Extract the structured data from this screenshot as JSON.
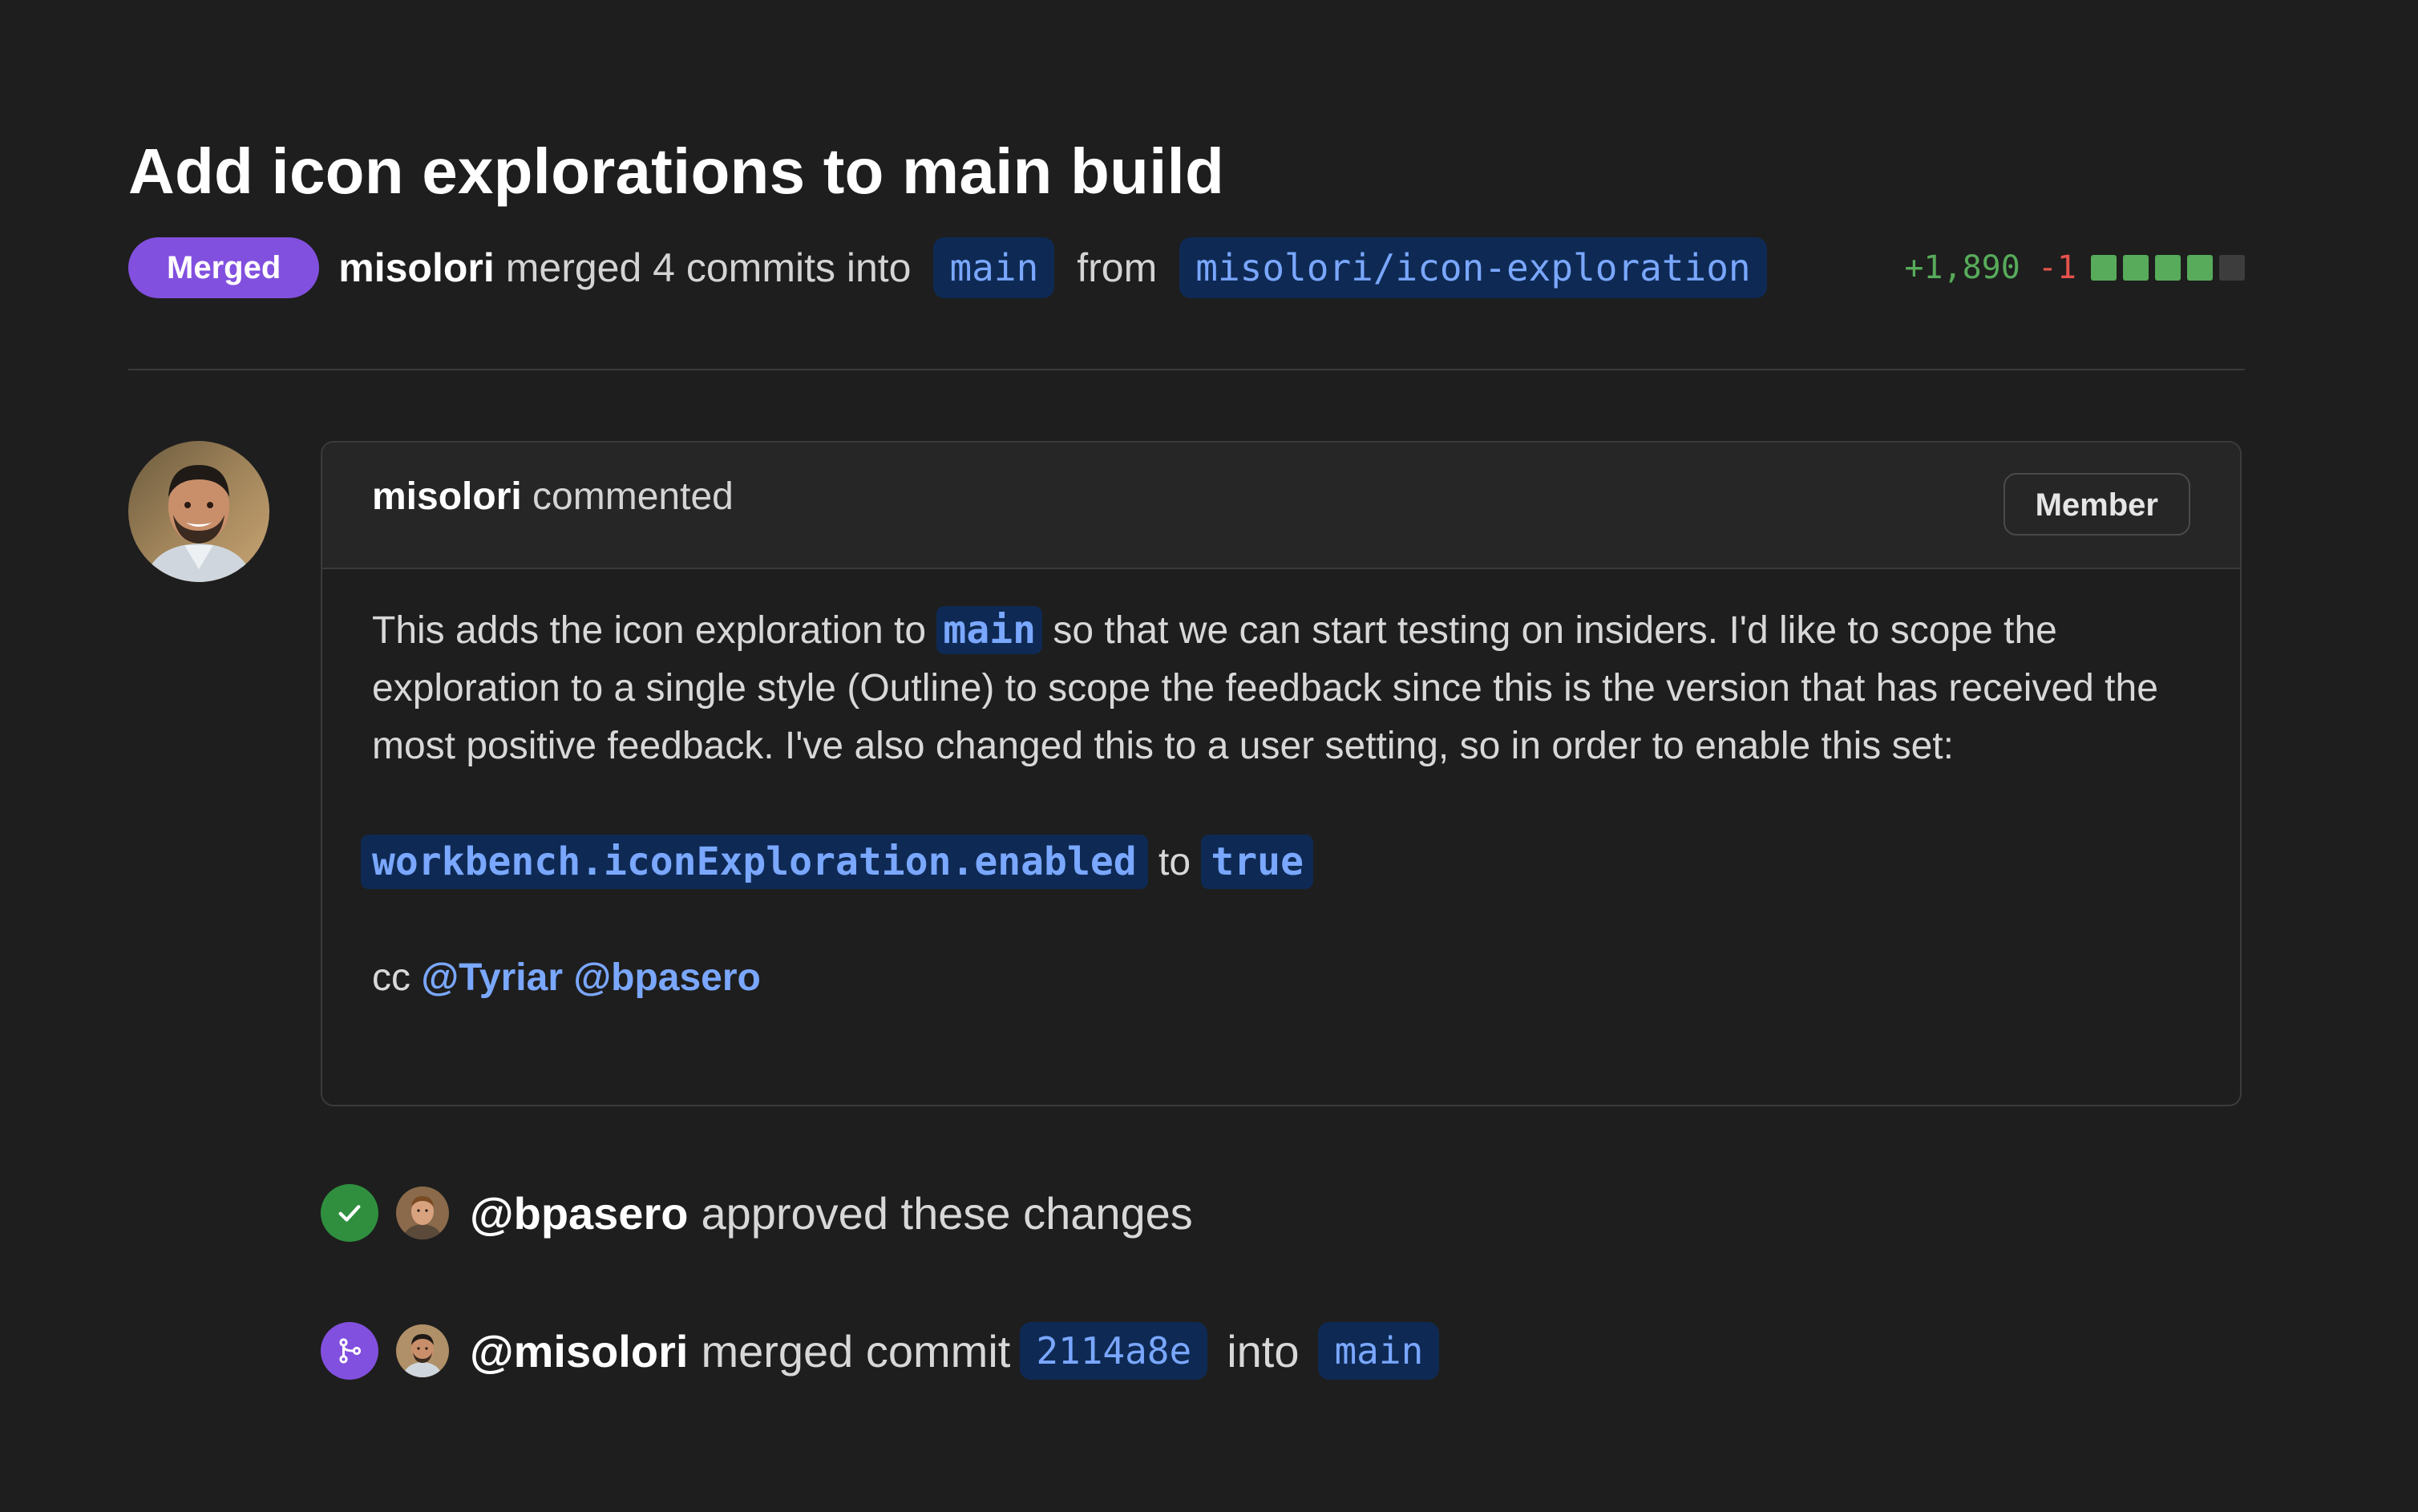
{
  "pr": {
    "title": "Add icon explorations to main build",
    "status_badge": "Merged",
    "author": "misolori",
    "merge_text": "merged 4 commits into",
    "base_branch": "main",
    "from_text": "from",
    "head_branch": "misolori/icon-exploration",
    "additions": "+1,890",
    "deletions": "-1"
  },
  "comment": {
    "author": "misolori",
    "action": "commented",
    "role_badge": "Member",
    "body_before_code": "This adds the icon exploration to",
    "body_inline_code": "main",
    "body_after_code": "so that we can start testing on insiders. I'd like to scope the exploration to a single style (Outline) to scope the feedback since this is the version that has received the most positive feedback. I've also changed this to a user setting, so in order to enable this set:",
    "setting_key": "workbench.iconExploration.enabled",
    "setting_to": "to",
    "setting_value": "true",
    "cc_label": "cc",
    "mention_1": "@Tyriar",
    "mention_2": "@bpasero"
  },
  "timeline": {
    "approval_user": "@bpasero",
    "approval_text": "approved these changes",
    "merge_user": "@misolori",
    "merge_text": "merged commit",
    "commit_sha": "2114a8e",
    "into_text": "into",
    "merge_branch": "main"
  },
  "colors": {
    "background": "#1e1e1e",
    "merged_purple": "#8250df",
    "approved_green": "#2f8f3e",
    "branch_bg": "#0e2a54",
    "branch_text": "#7aa7ff",
    "additions_green": "#57ab5a",
    "deletions_red": "#e5534b"
  },
  "icons": {
    "approval": "check-icon",
    "merge": "git-merge-icon"
  }
}
